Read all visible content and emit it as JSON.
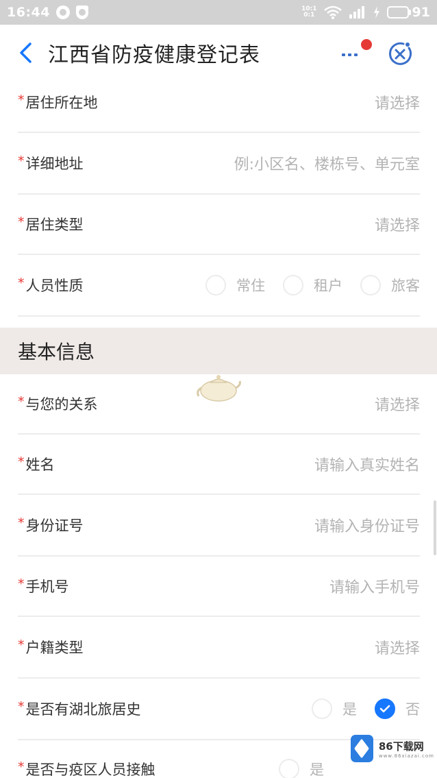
{
  "status_bar": {
    "time": "16:44",
    "network_top": "10:1",
    "network_bottom": "0:1",
    "battery_level": "91",
    "icons": [
      "notification-icon",
      "shield-icon",
      "wifi-icon",
      "signal-icon",
      "charging-icon",
      "battery-icon"
    ]
  },
  "header": {
    "title": "江西省防疫健康登记表"
  },
  "top_form": {
    "fields": [
      {
        "label": "居住所在地",
        "value": "请选择"
      },
      {
        "label": "详细地址",
        "value": "例:小区名、楼栋号、单元室"
      },
      {
        "label": "居住类型",
        "value": "请选择"
      }
    ],
    "personnel": {
      "label": "人员性质",
      "options": [
        "常住",
        "租户",
        "旅客"
      ]
    }
  },
  "basic_info": {
    "title": "基本信息",
    "fields": [
      {
        "label": "与您的关系",
        "value": "请选择"
      },
      {
        "label": "姓名",
        "value": "请输入真实姓名"
      },
      {
        "label": "身份证号",
        "value": "请输入身份证号"
      },
      {
        "label": "手机号",
        "value": "请输入手机号"
      },
      {
        "label": "户籍类型",
        "value": "请选择"
      }
    ],
    "hubei_history": {
      "label": "是否有湖北旅居史",
      "options": [
        "是",
        "否"
      ],
      "selected": "否"
    },
    "contact_history": {
      "label": "是否与疫区人员接触",
      "options": [
        "是"
      ]
    }
  },
  "required_mark": "*",
  "watermark": {
    "name": "86下载网",
    "site": "www.86xiazai.com"
  },
  "colors": {
    "accent": "#1677ff",
    "required": "#e53935",
    "placeholder": "#b3b3b3",
    "section_bg": "#efeae8",
    "status_bar": "#d2d2d2"
  }
}
